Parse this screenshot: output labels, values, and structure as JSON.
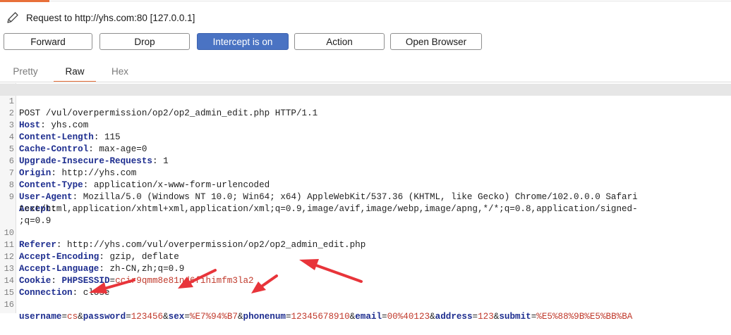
{
  "request": {
    "title": "Request to http://yhs.com:80  [127.0.0.1]"
  },
  "buttons": {
    "forward": "Forward",
    "drop": "Drop",
    "intercept": "Intercept is on",
    "action": "Action",
    "open_browser": "Open Browser"
  },
  "tabs": {
    "pretty": "Pretty",
    "raw": "Raw",
    "hex": "Hex"
  },
  "editor": {
    "line_numbers": [
      "1",
      "2",
      "3",
      "4",
      "5",
      "6",
      "7",
      "8",
      "9",
      "",
      "",
      "10",
      "11",
      "12",
      "13",
      "14",
      "15",
      "16"
    ],
    "request_line": "POST /vul/overpermission/op2/op2_admin_edit.php HTTP/1.1",
    "headers": [
      {
        "name": "Host",
        "value": "yhs.com"
      },
      {
        "name": "Content-Length",
        "value": "115"
      },
      {
        "name": "Cache-Control",
        "value": "max-age=0"
      },
      {
        "name": "Upgrade-Insecure-Requests",
        "value": "1"
      },
      {
        "name": "Origin",
        "value": "http://yhs.com"
      },
      {
        "name": "Content-Type",
        "value": "application/x-www-form-urlencoded"
      },
      {
        "name": "User-Agent",
        "value": "Mozilla/5.0 (Windows NT 10.0; Win64; x64) AppleWebKit/537.36 (KHTML, like Gecko) Chrome/102.0.0.0 Safari"
      },
      {
        "name": "Accept",
        "value": ""
      }
    ],
    "accept_cont1": "text/html,application/xhtml+xml,application/xml;q=0.9,image/avif,image/webp,image/apng,*/*;q=0.8,application/signed-",
    "accept_cont2": ";q=0.9",
    "headers2": [
      {
        "name": "Referer",
        "value": "http://yhs.com/vul/overpermission/op2/op2_admin_edit.php"
      },
      {
        "name": "Accept-Encoding",
        "value": "gzip, deflate"
      },
      {
        "name": "Accept-Language",
        "value": "zh-CN,zh;q=0.9"
      }
    ],
    "cookie": {
      "name": "Cookie",
      "param": "PHPSESSID",
      "value": "ccir9qmm8e81nd6fihimfm3la2"
    },
    "connection": {
      "name": "Connection",
      "value": "close"
    },
    "body_params": [
      {
        "name": "username",
        "value": "cs"
      },
      {
        "name": "password",
        "value": "123456"
      },
      {
        "name": "sex",
        "value": "%E7%94%B7"
      },
      {
        "name": "phonenum",
        "value": "12345678910"
      },
      {
        "name": "email",
        "value": "00%40123"
      },
      {
        "name": "address",
        "value": "123"
      },
      {
        "name": "submit",
        "value": "%E5%88%9B%E5%BB%BA"
      }
    ]
  },
  "colors": {
    "accent": "#e8703a",
    "intercept_button": "#4a73c3",
    "header_name": "#1d2d8f",
    "param_value": "#c0392b",
    "annotation_arrow": "#e8343a"
  },
  "icons": {
    "request": "pencil-icon"
  }
}
